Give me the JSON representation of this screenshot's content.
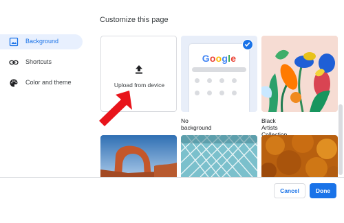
{
  "dialog": {
    "title": "Customize this page"
  },
  "sidebar": {
    "items": [
      {
        "label": "Background",
        "icon": "background-icon",
        "active": true
      },
      {
        "label": "Shortcuts",
        "icon": "link-icon",
        "active": false
      },
      {
        "label": "Color and theme",
        "icon": "palette-icon",
        "active": false
      }
    ]
  },
  "backgrounds": {
    "upload_label": "Upload from device",
    "no_background_label": "No background",
    "black_artists_label": "Black Artists Collection",
    "preview_logo": "Google"
  },
  "footer": {
    "cancel_label": "Cancel",
    "done_label": "Done"
  },
  "colors": {
    "accent": "#1a73e8",
    "active_bg": "#e8f0fe",
    "annotation_arrow": "#e8141b"
  }
}
